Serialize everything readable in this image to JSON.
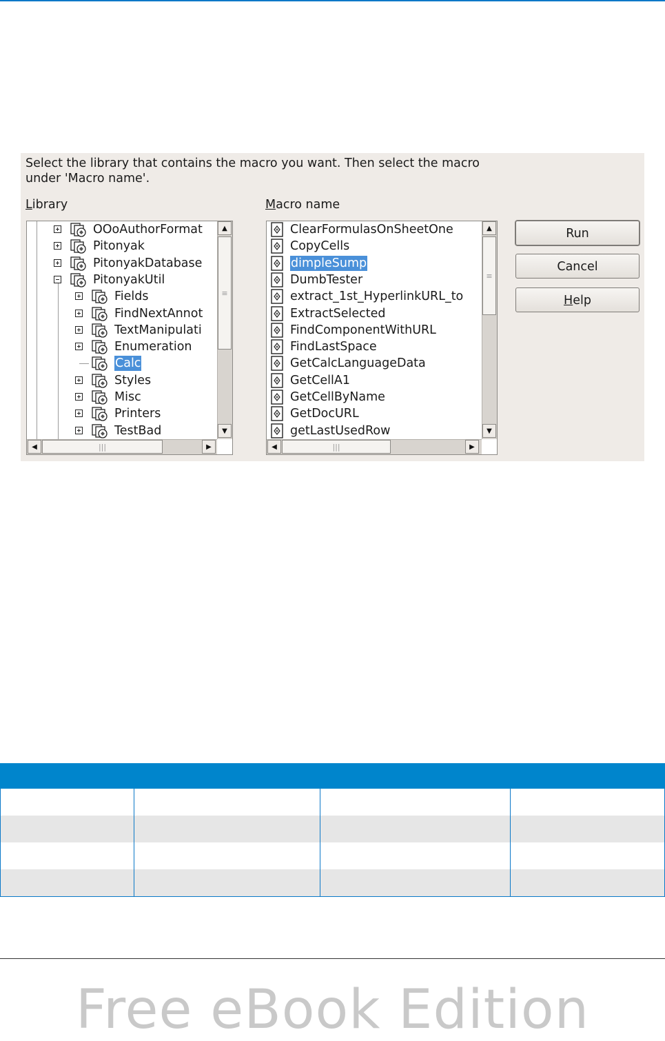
{
  "dialog": {
    "instructions": "Select the library that contains the macro you want. Then select the macro under 'Macro name'.",
    "library_label_mnemonic": "L",
    "library_label_rest": "ibrary",
    "macro_label_mnemonic": "M",
    "macro_label_rest": "acro name",
    "library_items": [
      {
        "label": "OOoAuthorFormat",
        "expander": "plus",
        "level": 1
      },
      {
        "label": "Pitonyak",
        "expander": "plus",
        "level": 1
      },
      {
        "label": "PitonyakDatabase",
        "expander": "plus",
        "level": 1
      },
      {
        "label": "PitonyakUtil",
        "expander": "minus",
        "level": 1
      },
      {
        "label": "Fields",
        "expander": "plus",
        "level": 2
      },
      {
        "label": "FindNextAnnot",
        "expander": "plus",
        "level": 2
      },
      {
        "label": "TextManipulati",
        "expander": "plus",
        "level": 2
      },
      {
        "label": "Enumeration",
        "expander": "plus",
        "level": 2
      },
      {
        "label": "Calc",
        "expander": "none",
        "level": 2,
        "selected": true
      },
      {
        "label": "Styles",
        "expander": "plus",
        "level": 2
      },
      {
        "label": "Misc",
        "expander": "plus",
        "level": 2
      },
      {
        "label": "Printers",
        "expander": "plus",
        "level": 2
      },
      {
        "label": "TestBad",
        "expander": "plus",
        "level": 2
      }
    ],
    "macro_items": [
      {
        "label": "ClearFormulasOnSheetOne"
      },
      {
        "label": "CopyCells"
      },
      {
        "label": "dimpleSump",
        "selected": true
      },
      {
        "label": "DumbTester"
      },
      {
        "label": "extract_1st_HyperlinkURL_to"
      },
      {
        "label": "ExtractSelected"
      },
      {
        "label": "FindComponentWithURL"
      },
      {
        "label": "FindLastSpace"
      },
      {
        "label": "GetCalcLanguageData"
      },
      {
        "label": "GetCellA1"
      },
      {
        "label": "GetCellByName"
      },
      {
        "label": "GetDocURL"
      },
      {
        "label": "getLastUsedRow"
      }
    ],
    "buttons": {
      "run": "Run",
      "cancel": "Cancel",
      "help_mnemonic": "H",
      "help_rest": "elp"
    }
  },
  "footer": {
    "watermark": "Free eBook Edition"
  },
  "colors": {
    "accent": "#0085cc",
    "selection": "#4a90d9",
    "dialog_bg": "#efebe7"
  }
}
